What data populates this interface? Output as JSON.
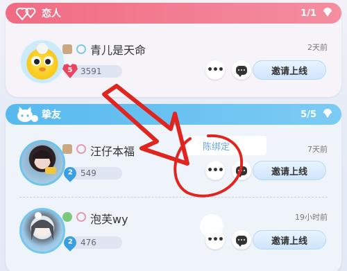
{
  "colors": {
    "lovers_header": "#f06b83",
    "friends_header": "#58b9ee",
    "annotation_red": "#e0241f"
  },
  "sections": {
    "lovers": {
      "title": "恋人",
      "count": "1/1"
    },
    "friends": {
      "title": "挚友",
      "count": "5/5"
    }
  },
  "friends_list": [
    {
      "name": "青儿是天命",
      "time": "2天前",
      "level": "5",
      "level_badge": "heart",
      "score": "3591",
      "invite_label": "邀请上线"
    },
    {
      "name": "汪仔本福",
      "time": "7天前",
      "level": "2",
      "level_badge": "drop",
      "score": "549",
      "invite_label": "邀请上线"
    },
    {
      "name": "泡芙wy",
      "time": "19小时前",
      "level": "2",
      "level_badge": "drop",
      "score": "476",
      "invite_label": "邀请上线"
    }
  ],
  "overlay": {
    "text": "陈绑定"
  },
  "icons": {
    "more": "more-dots-icon",
    "chat": "chat-bubble-icon",
    "collapse": "caret-down-icon",
    "section_lovers": "hearts-icon",
    "section_friends": "cat-icon"
  }
}
